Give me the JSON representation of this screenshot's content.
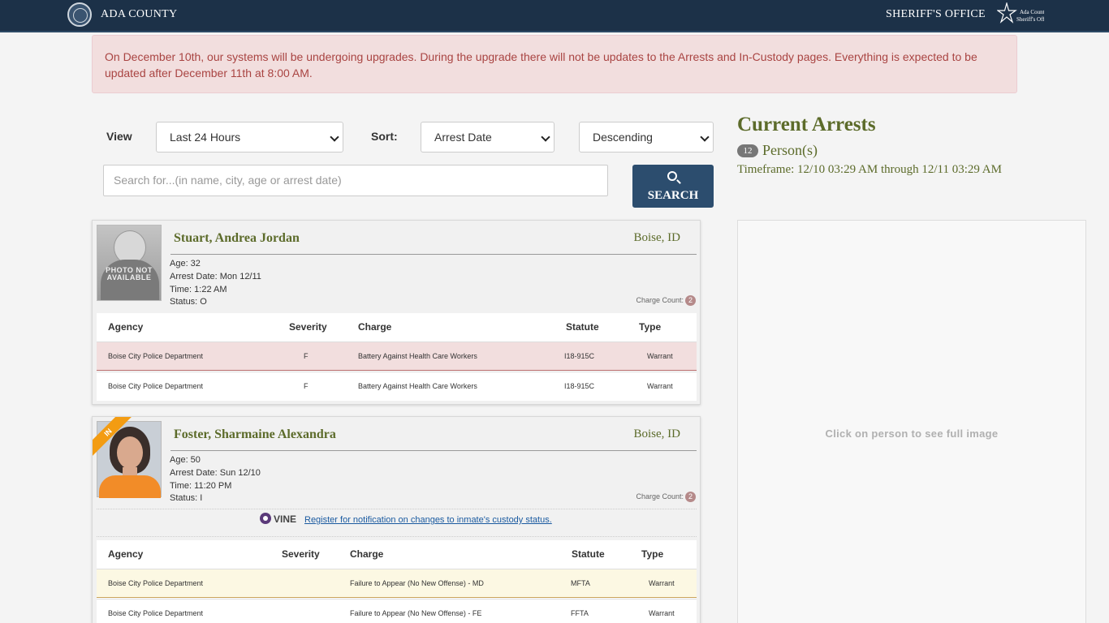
{
  "header": {
    "left_title": "ADA COUNTY",
    "right_title": "SHERIFF'S OFFICE"
  },
  "alert": {
    "text": "On December 10th, our systems will be undergoing upgrades. During the upgrade there will not be updates to the Arrests and In-Custody pages. Everything is expected to be updated after December 11th at 8:00 AM."
  },
  "controls": {
    "view_label": "View",
    "view_value": "Last 24 Hours",
    "sort_label": "Sort:",
    "sort_value": "Arrest Date",
    "order_value": "Descending",
    "search_placeholder": "Search for...(in name, city, age or arrest date)",
    "search_button": "SEARCH"
  },
  "summary": {
    "title": "Current Arrests",
    "count": "12",
    "count_label": "Person(s)",
    "timeframe": "Timeframe: 12/10 03:29 AM through 12/11 03:29 AM",
    "image_hint": "Click on person to see full image"
  },
  "table_headers": {
    "agency": "Agency",
    "severity": "Severity",
    "charge": "Charge",
    "statute": "Statute",
    "type": "Type"
  },
  "persons": [
    {
      "name": "Stuart, Andrea Jordan",
      "city": "Boise, ID",
      "photo_text": "PHOTO NOT AVAILABLE",
      "age": "Age: 32",
      "arrest_date": "Arrest Date: Mon 12/11",
      "time": "Time: 1:22 AM",
      "status": "Status: O",
      "charge_count_label": "Charge Count:",
      "charge_count": "2",
      "charges": [
        {
          "agency": "Boise City Police Department",
          "severity": "F",
          "charge": "Battery Against Health Care Workers",
          "statute": "I18-915C",
          "type": "Warrant"
        },
        {
          "agency": "Boise City Police Department",
          "severity": "F",
          "charge": "Battery Against Health Care Workers",
          "statute": "I18-915C",
          "type": "Warrant"
        }
      ]
    },
    {
      "name": "Foster, Sharmaine Alexandra",
      "city": "Boise, ID",
      "ribbon": "IN",
      "age": "Age: 50",
      "arrest_date": "Arrest Date: Sun 12/10",
      "time": "Time: 11:20 PM",
      "status": "Status: I",
      "charge_count_label": "Charge Count:",
      "charge_count": "2",
      "vine_brand": "VINE",
      "vine_link": "Register for notification on changes to inmate's custody status.",
      "charges": [
        {
          "agency": "Boise City Police Department",
          "severity": "",
          "charge": "Failure to Appear (No New Offense) - MD",
          "statute": "MFTA",
          "type": "Warrant"
        },
        {
          "agency": "Boise City Police Department",
          "severity": "",
          "charge": "Failure to Appear (No New Offense) - FE",
          "statute": "FFTA",
          "type": "Warrant"
        }
      ]
    }
  ]
}
